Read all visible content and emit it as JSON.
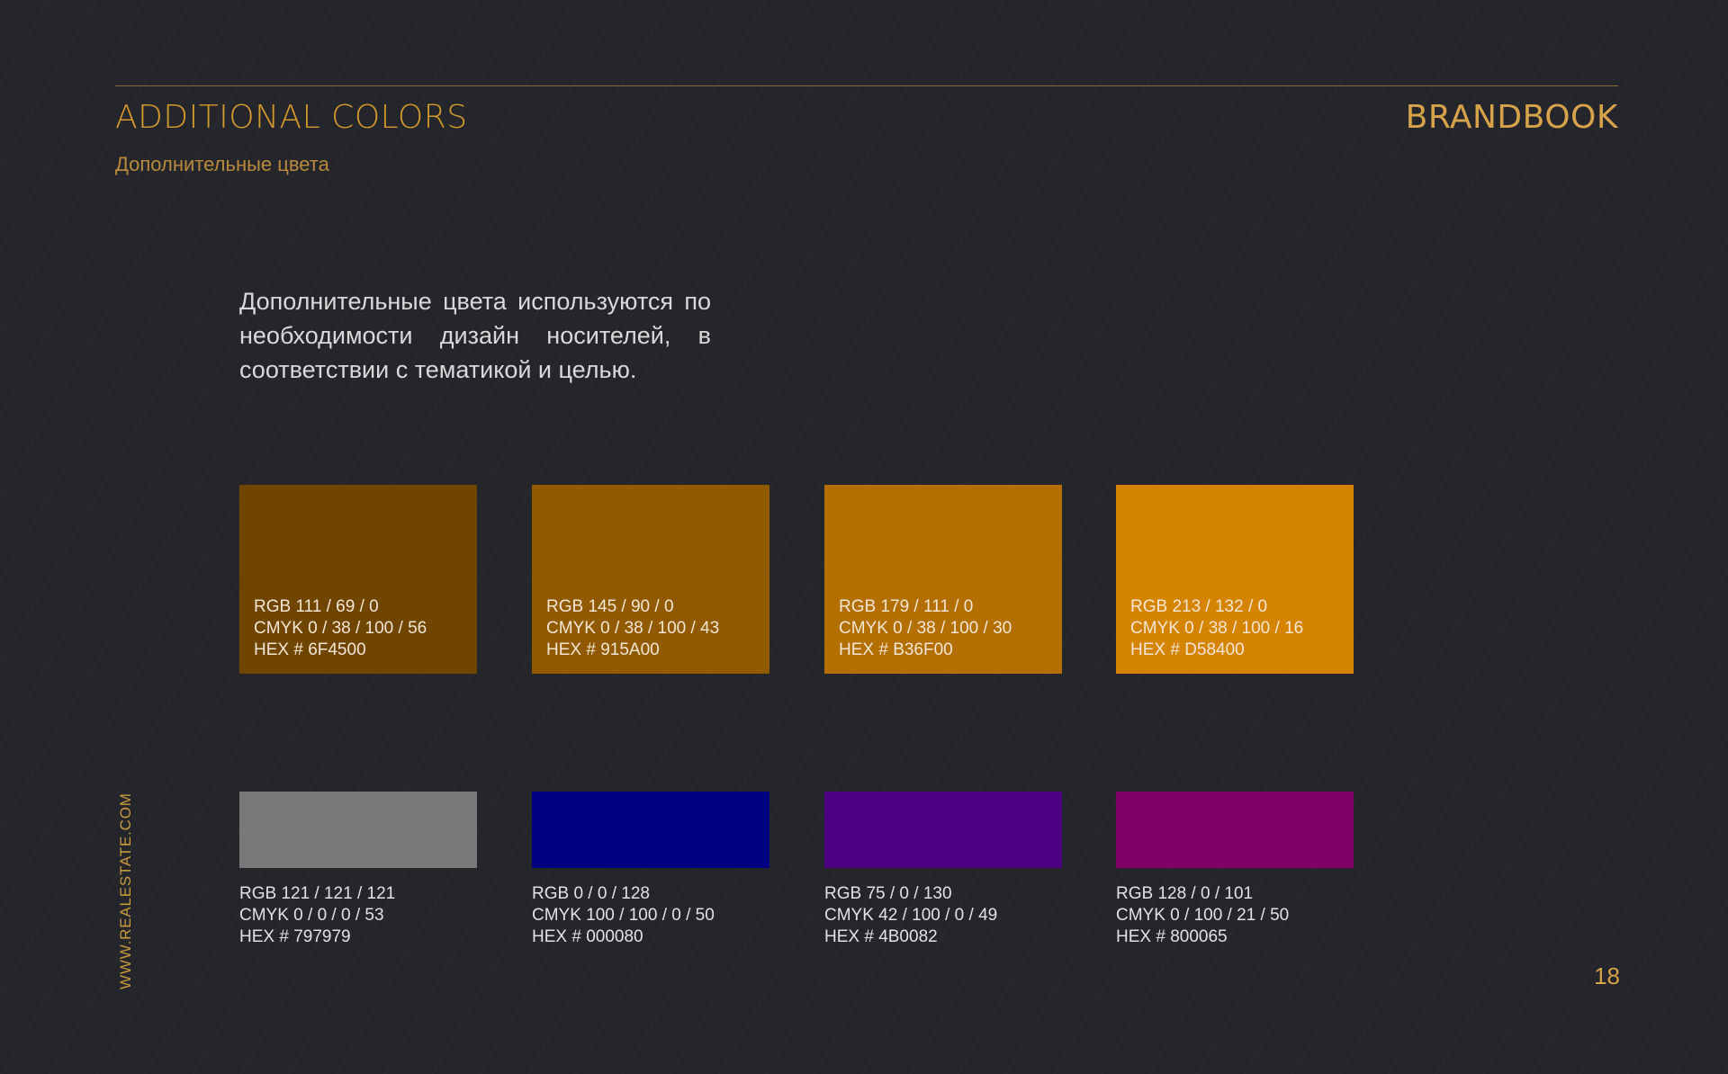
{
  "header": {
    "title": "ADDITIONAL COLORS",
    "subtitle": "Дополнительные цвета",
    "brand": "BRANDBOOK"
  },
  "description": "Дополнительные цвета используются по необходимости дизайн носителей, в соответствии с тематикой и целью.",
  "swatches_top": [
    {
      "color": "#6F4500",
      "rgb": "RGB 111 / 69 / 0",
      "cmyk": "CMYK 0 / 38 / 100 / 56",
      "hex": "HEX # 6F4500"
    },
    {
      "color": "#915A00",
      "rgb": "RGB 145 / 90 / 0",
      "cmyk": "CMYK 0 / 38 / 100 / 43",
      "hex": "HEX # 915A00"
    },
    {
      "color": "#B36F00",
      "rgb": "RGB 179 / 111 / 0",
      "cmyk": "CMYK 0 / 38 / 100 / 30",
      "hex": "HEX # B36F00"
    },
    {
      "color": "#D58400",
      "rgb": "RGB 213 / 132 / 0",
      "cmyk": "CMYK 0 / 38 / 100 / 16",
      "hex": "HEX # D58400"
    }
  ],
  "swatches_bottom": [
    {
      "color": "#797979",
      "rgb": "RGB 121 / 121 / 121",
      "cmyk": "CMYK 0 / 0 / 0 / 53",
      "hex": "HEX # 797979"
    },
    {
      "color": "#000080",
      "rgb": "RGB 0 / 0 / 128",
      "cmyk": "CMYK 100 / 100 / 0 / 50",
      "hex": "HEX # 000080"
    },
    {
      "color": "#4B0082",
      "rgb": "RGB 75 / 0 / 130",
      "cmyk": "CMYK 42 / 100 / 0 / 49",
      "hex": "HEX # 4B0082"
    },
    {
      "color": "#800065",
      "rgb": "RGB 128 / 0 / 101",
      "cmyk": "CMYK 0 / 100 / 21 / 50",
      "hex": "HEX # 800065"
    }
  ],
  "footer": {
    "url": "WWW.REALESTATE.COM",
    "page_number": "18"
  }
}
